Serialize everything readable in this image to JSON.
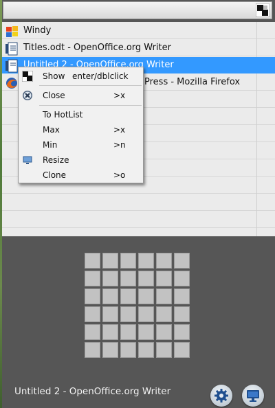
{
  "colors": {
    "selection": "#3399ff",
    "panel": "#565656",
    "list_bg": "#ebebeb"
  },
  "window_list": {
    "items": [
      {
        "label": "Windy",
        "icon": "windy-flag-icon",
        "selected": false
      },
      {
        "label": "Titles.odt - OpenOffice.org Writer",
        "icon": "writer-document-icon",
        "selected": false
      },
      {
        "label": "Untitled 2 - OpenOffice.org Writer",
        "icon": "writer-document-icon",
        "selected": true
      },
      {
        "label": "Press - Mozilla Firefox",
        "icon": "firefox-icon",
        "selected": false
      }
    ]
  },
  "context_menu": {
    "show": {
      "label": "Show",
      "shortcut": "enter/dblclick",
      "icon": "show-window-icon"
    },
    "close": {
      "label": "Close",
      "shortcut": ">x",
      "icon": "close-icon"
    },
    "to_hotlist": {
      "label": "To HotList"
    },
    "max": {
      "label": "Max",
      "shortcut": ">x"
    },
    "min": {
      "label": "Min",
      "shortcut": ">n"
    },
    "resize": {
      "label": "Resize",
      "icon": "resize-icon"
    },
    "clone": {
      "label": "Clone",
      "shortcut": ">o"
    }
  },
  "desktop_grid": {
    "rows": 6,
    "cols": 6
  },
  "status": {
    "title": "Untitled 2 - OpenOffice.org Writer"
  },
  "buttons": {
    "settings_icon": "gear-icon",
    "desktop_icon": "monitor-icon"
  }
}
